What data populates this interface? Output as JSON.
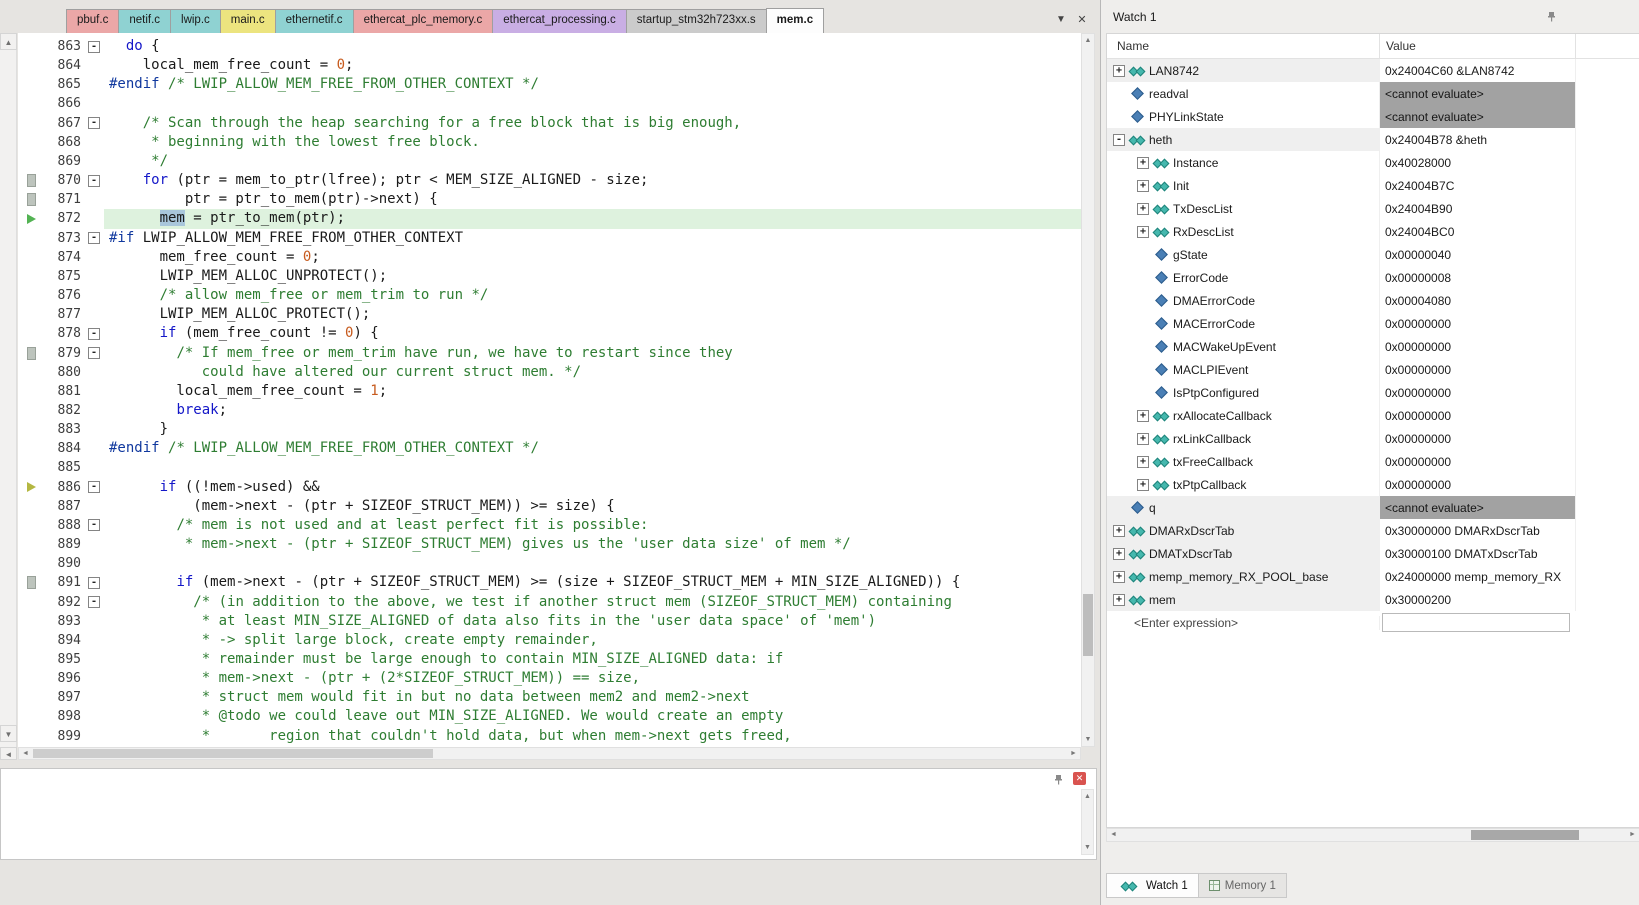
{
  "tabbar": {
    "dropdown_icon": "▼",
    "close_icon": "✕",
    "tabs": [
      {
        "label": "pbuf.c",
        "color": "#eba7a7",
        "active": false
      },
      {
        "label": "netif.c",
        "color": "#8fd2d2",
        "active": false
      },
      {
        "label": "lwip.c",
        "color": "#8fd2d2",
        "active": false
      },
      {
        "label": "main.c",
        "color": "#ece47f",
        "active": false
      },
      {
        "label": "ethernetif.c",
        "color": "#8fd2d2",
        "active": false
      },
      {
        "label": "ethercat_plc_memory.c",
        "color": "#eba7a7",
        "active": false
      },
      {
        "label": "ethercat_processing.c",
        "color": "#c9aee4",
        "active": false
      },
      {
        "label": "startup_stm32h723xx.s",
        "color": "#cbcbcb",
        "active": false
      },
      {
        "label": "mem.c",
        "color": "#fdfdfd",
        "active": true
      }
    ]
  },
  "editor": {
    "lines": [
      {
        "num": 863,
        "fold": true,
        "segs": [
          [
            "t",
            "  "
          ],
          [
            "k",
            "do"
          ],
          [
            "t",
            " {"
          ]
        ]
      },
      {
        "num": 864,
        "segs": [
          [
            "t",
            "    local_mem_free_count = "
          ],
          [
            "n",
            "0"
          ],
          [
            "t",
            ";"
          ]
        ]
      },
      {
        "num": 865,
        "segs": [
          [
            "p",
            "#endif"
          ],
          [
            "t",
            " "
          ],
          [
            "c",
            "/* LWIP_ALLOW_MEM_FREE_FROM_OTHER_CONTEXT */"
          ]
        ]
      },
      {
        "num": 866,
        "segs": []
      },
      {
        "num": 867,
        "fold": true,
        "segs": [
          [
            "t",
            "    "
          ],
          [
            "c",
            "/* Scan through the heap searching for a free block that is big enough,"
          ]
        ]
      },
      {
        "num": 868,
        "segs": [
          [
            "c",
            "     * beginning with the lowest free block."
          ]
        ]
      },
      {
        "num": 869,
        "segs": [
          [
            "c",
            "     */"
          ]
        ]
      },
      {
        "num": 870,
        "fold": true,
        "icon": "square",
        "segs": [
          [
            "t",
            "    "
          ],
          [
            "k",
            "for"
          ],
          [
            "t",
            " (ptr = mem_to_ptr(lfree); ptr < MEM_SIZE_ALIGNED - size;"
          ]
        ]
      },
      {
        "num": 871,
        "icon": "square",
        "segs": [
          [
            "t",
            "         ptr = ptr_to_mem(ptr)->next) {"
          ]
        ]
      },
      {
        "num": 872,
        "current": true,
        "icon": "arrow-green",
        "segs": [
          [
            "t",
            "      "
          ],
          [
            "sel",
            "mem"
          ],
          [
            "t",
            " = ptr_to_mem(ptr);"
          ]
        ]
      },
      {
        "num": 873,
        "fold": true,
        "segs": [
          [
            "p",
            "#if"
          ],
          [
            "t",
            " LWIP_ALLOW_MEM_FREE_FROM_OTHER_CONTEXT"
          ]
        ]
      },
      {
        "num": 874,
        "segs": [
          [
            "t",
            "      mem_free_count = "
          ],
          [
            "n",
            "0"
          ],
          [
            "t",
            ";"
          ]
        ]
      },
      {
        "num": 875,
        "segs": [
          [
            "t",
            "      LWIP_MEM_ALLOC_UNPROTECT();"
          ]
        ]
      },
      {
        "num": 876,
        "segs": [
          [
            "t",
            "      "
          ],
          [
            "c",
            "/* allow mem_free or mem_trim to run */"
          ]
        ]
      },
      {
        "num": 877,
        "segs": [
          [
            "t",
            "      LWIP_MEM_ALLOC_PROTECT();"
          ]
        ]
      },
      {
        "num": 878,
        "fold": true,
        "segs": [
          [
            "t",
            "      "
          ],
          [
            "k",
            "if"
          ],
          [
            "t",
            " (mem_free_count != "
          ],
          [
            "n",
            "0"
          ],
          [
            "t",
            ") {"
          ]
        ]
      },
      {
        "num": 879,
        "fold": true,
        "icon": "square",
        "segs": [
          [
            "t",
            "        "
          ],
          [
            "c",
            "/* If mem_free or mem_trim have run, we have to restart since they"
          ]
        ]
      },
      {
        "num": 880,
        "segs": [
          [
            "c",
            "           could have altered our current struct mem. */"
          ]
        ]
      },
      {
        "num": 881,
        "segs": [
          [
            "t",
            "        local_mem_free_count = "
          ],
          [
            "n",
            "1"
          ],
          [
            "t",
            ";"
          ]
        ]
      },
      {
        "num": 882,
        "segs": [
          [
            "t",
            "        "
          ],
          [
            "k",
            "break"
          ],
          [
            "t",
            ";"
          ]
        ]
      },
      {
        "num": 883,
        "segs": [
          [
            "t",
            "      }"
          ]
        ]
      },
      {
        "num": 884,
        "segs": [
          [
            "p",
            "#endif"
          ],
          [
            "t",
            " "
          ],
          [
            "c",
            "/* LWIP_ALLOW_MEM_FREE_FROM_OTHER_CONTEXT */"
          ]
        ]
      },
      {
        "num": 885,
        "segs": []
      },
      {
        "num": 886,
        "fold": true,
        "icon": "arrow-yellow",
        "segs": [
          [
            "t",
            "      "
          ],
          [
            "k",
            "if"
          ],
          [
            "t",
            " ((!mem->used) &&"
          ]
        ]
      },
      {
        "num": 887,
        "segs": [
          [
            "t",
            "          (mem->next - (ptr + SIZEOF_STRUCT_MEM)) >= size) {"
          ]
        ]
      },
      {
        "num": 888,
        "fold": true,
        "segs": [
          [
            "t",
            "        "
          ],
          [
            "c",
            "/* mem is not used and at least perfect fit is possible:"
          ]
        ]
      },
      {
        "num": 889,
        "segs": [
          [
            "c",
            "         * mem->next - (ptr + SIZEOF_STRUCT_MEM) gives us the 'user data size' of mem */"
          ]
        ]
      },
      {
        "num": 890,
        "segs": []
      },
      {
        "num": 891,
        "fold": true,
        "icon": "square",
        "segs": [
          [
            "t",
            "        "
          ],
          [
            "k",
            "if"
          ],
          [
            "t",
            " (mem->next - (ptr + SIZEOF_STRUCT_MEM) >= (size + SIZEOF_STRUCT_MEM + MIN_SIZE_ALIGNED)) {"
          ]
        ]
      },
      {
        "num": 892,
        "fold": true,
        "segs": [
          [
            "t",
            "          "
          ],
          [
            "c",
            "/* (in addition to the above, we test if another struct mem (SIZEOF_STRUCT_MEM) containing"
          ]
        ]
      },
      {
        "num": 893,
        "segs": [
          [
            "c",
            "           * at least MIN_SIZE_ALIGNED of data also fits in the 'user data space' of 'mem')"
          ]
        ]
      },
      {
        "num": 894,
        "segs": [
          [
            "c",
            "           * -> split large block, create empty remainder,"
          ]
        ]
      },
      {
        "num": 895,
        "segs": [
          [
            "c",
            "           * remainder must be large enough to contain MIN_SIZE_ALIGNED data: if"
          ]
        ]
      },
      {
        "num": 896,
        "segs": [
          [
            "c",
            "           * mem->next - (ptr + (2*SIZEOF_STRUCT_MEM)) == size,"
          ]
        ]
      },
      {
        "num": 897,
        "segs": [
          [
            "c",
            "           * struct mem would fit in but no data between mem2 and mem2->next"
          ]
        ]
      },
      {
        "num": 898,
        "segs": [
          [
            "c",
            "           * @todo we could leave out MIN_SIZE_ALIGNED. We would create an empty"
          ]
        ]
      },
      {
        "num": 899,
        "segs": [
          [
            "c",
            "           *       region that couldn't hold data, but when mem->next gets freed,"
          ]
        ]
      }
    ]
  },
  "watch": {
    "title": "Watch 1",
    "columns": [
      "Name",
      "Value"
    ],
    "enter_expression": "<Enter expression>",
    "rows": [
      {
        "name": "LAN8742",
        "value": "0x24004C60 &LAN8742",
        "indent": 0,
        "expand": "plus",
        "icon": "watch",
        "shade": true
      },
      {
        "name": "readval",
        "value": "<cannot evaluate>",
        "indent": 0,
        "expand": "none",
        "icon": "diamond",
        "gray": true
      },
      {
        "name": "PHYLinkState",
        "value": "<cannot evaluate>",
        "indent": 0,
        "expand": "none",
        "icon": "diamond",
        "gray": true
      },
      {
        "name": "heth",
        "value": "0x24004B78 &heth",
        "indent": 0,
        "expand": "minus",
        "icon": "watch",
        "shade": true
      },
      {
        "name": "Instance",
        "value": "0x40028000",
        "indent": 1,
        "expand": "plus",
        "icon": "watch"
      },
      {
        "name": "Init",
        "value": "0x24004B7C",
        "indent": 1,
        "expand": "plus",
        "icon": "watch"
      },
      {
        "name": "TxDescList",
        "value": "0x24004B90",
        "indent": 1,
        "expand": "plus",
        "icon": "watch"
      },
      {
        "name": "RxDescList",
        "value": "0x24004BC0",
        "indent": 1,
        "expand": "plus",
        "icon": "watch"
      },
      {
        "name": "gState",
        "value": "0x00000040",
        "indent": 1,
        "expand": "none",
        "icon": "diamond"
      },
      {
        "name": "ErrorCode",
        "value": "0x00000008",
        "indent": 1,
        "expand": "none",
        "icon": "diamond"
      },
      {
        "name": "DMAErrorCode",
        "value": "0x00004080",
        "indent": 1,
        "expand": "none",
        "icon": "diamond"
      },
      {
        "name": "MACErrorCode",
        "value": "0x00000000",
        "indent": 1,
        "expand": "none",
        "icon": "diamond"
      },
      {
        "name": "MACWakeUpEvent",
        "value": "0x00000000",
        "indent": 1,
        "expand": "none",
        "icon": "diamond"
      },
      {
        "name": "MACLPIEvent",
        "value": "0x00000000",
        "indent": 1,
        "expand": "none",
        "icon": "diamond"
      },
      {
        "name": "IsPtpConfigured",
        "value": "0x00000000",
        "indent": 1,
        "expand": "none",
        "icon": "diamond"
      },
      {
        "name": "rxAllocateCallback",
        "value": "0x00000000",
        "indent": 1,
        "expand": "plus",
        "icon": "watch"
      },
      {
        "name": "rxLinkCallback",
        "value": "0x00000000",
        "indent": 1,
        "expand": "plus",
        "icon": "watch"
      },
      {
        "name": "txFreeCallback",
        "value": "0x00000000",
        "indent": 1,
        "expand": "plus",
        "icon": "watch"
      },
      {
        "name": "txPtpCallback",
        "value": "0x00000000",
        "indent": 1,
        "expand": "plus",
        "icon": "watch"
      },
      {
        "name": "q",
        "value": "<cannot evaluate>",
        "indent": 0,
        "expand": "none",
        "icon": "diamond",
        "gray": true,
        "shade": true
      },
      {
        "name": "DMARxDscrTab",
        "value": "0x30000000 DMARxDscrTab",
        "indent": 0,
        "expand": "plus",
        "icon": "watch",
        "shade": true
      },
      {
        "name": "DMATxDscrTab",
        "value": "0x30000100 DMATxDscrTab",
        "indent": 0,
        "expand": "plus",
        "icon": "watch",
        "shade": true
      },
      {
        "name": "memp_memory_RX_POOL_base",
        "value": "0x24000000 memp_memory_RX",
        "indent": 0,
        "expand": "plus",
        "icon": "watch",
        "shade": true
      },
      {
        "name": "mem",
        "value": "0x30000200",
        "indent": 0,
        "expand": "plus",
        "icon": "watch",
        "shade": true
      }
    ],
    "tabs": [
      {
        "label": "Watch 1",
        "active": true,
        "icon": "watch"
      },
      {
        "label": "Memory 1",
        "active": false,
        "icon": "memory"
      }
    ]
  }
}
